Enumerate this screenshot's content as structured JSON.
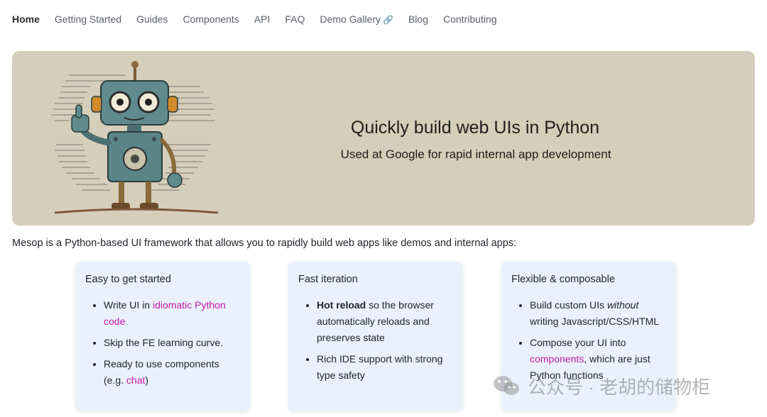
{
  "nav": {
    "items": [
      "Home",
      "Getting Started",
      "Guides",
      "Components",
      "API",
      "FAQ",
      "Demo Gallery",
      "Blog",
      "Contributing"
    ],
    "active": "Home",
    "external_icon": "link-icon"
  },
  "hero": {
    "title": "Quickly build web UIs in Python",
    "subtitle": "Used at Google for rapid internal app development",
    "background_color": "#d4ceba",
    "image": "robot-illustration"
  },
  "intro": "Mesop is a Python-based UI framework that allows you to rapidly build web apps like demos and internal apps:",
  "cards": [
    {
      "title": "Easy to get started",
      "items": [
        {
          "parts": [
            {
              "text": "Write UI in "
            },
            {
              "text": "idiomatic Python code",
              "link": true
            }
          ]
        },
        {
          "parts": [
            {
              "text": "Skip the FE learning curve."
            }
          ]
        },
        {
          "parts": [
            {
              "text": "Ready to use components (e.g. "
            },
            {
              "text": "chat",
              "link": true
            },
            {
              "text": ")"
            }
          ]
        }
      ]
    },
    {
      "title": "Fast iteration",
      "items": [
        {
          "parts": [
            {
              "text": "Hot reload",
              "bold": true
            },
            {
              "text": " so the browser automatically reloads and preserves state"
            }
          ]
        },
        {
          "parts": [
            {
              "text": "Rich IDE support with strong type safety"
            }
          ]
        }
      ]
    },
    {
      "title": "Flexible & composable",
      "items": [
        {
          "parts": [
            {
              "text": "Build custom UIs "
            },
            {
              "text": "without",
              "italic": true
            },
            {
              "text": " writing Javascript/CSS/HTML"
            }
          ]
        },
        {
          "parts": [
            {
              "text": "Compose your UI into "
            },
            {
              "text": "components",
              "link": true
            },
            {
              "text": ", which are just Python functions"
            }
          ]
        }
      ]
    }
  ],
  "colors": {
    "link": "#c41aa5",
    "card_bg": "#eaf1fd"
  },
  "watermark": {
    "text": "公众号 · 老胡的储物柜",
    "icon": "wechat-icon"
  }
}
